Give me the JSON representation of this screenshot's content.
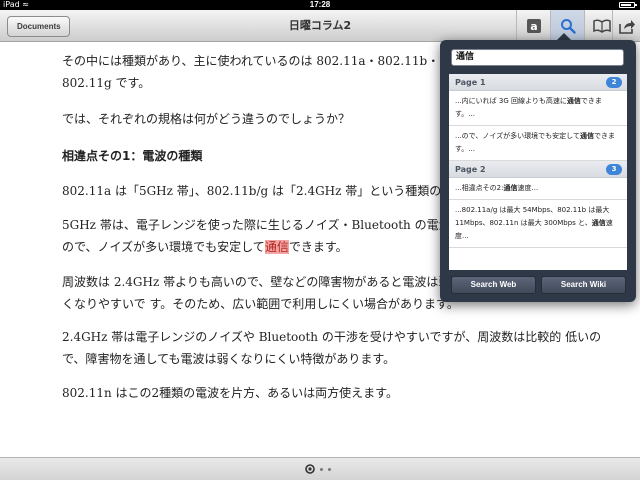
{
  "status_bar": {
    "carrier": "iPad",
    "time": "17:28",
    "battery_level": 0.85
  },
  "nav_bar": {
    "back_label": "Documents",
    "title": "日曜コラム2",
    "icons": [
      "font-icon",
      "search-icon",
      "book-icon",
      "share-icon"
    ]
  },
  "document": {
    "p1": "その中には種類があり、主に使われているのは 802.11a・802.11b・802.11g です。",
    "p2": "では、それぞれの規格は何がどう違うのでしょうか？",
    "heading": "相違点その1：電波の種類",
    "p3": "802.11a は「5GHz 帯」、802.11b/g は「2.4GHz 帯」という種類の電波を",
    "p4_before": "5GHz 帯は、電子レンジを使った際に生じるノイズ・Bluetooth の電波",
    "p4_line2_before": "ので、ノイズが多い環境でも安定して",
    "p4_highlight": "通信",
    "p4_after": "できます。",
    "p5": "周波数は 2.4GHz 帯よりも高いので、壁などの障害物があると電波は弱くなりやすいで す。そのため、広い範囲で利用しにくい場合があります。",
    "p6": "2.4GHz 帯は電子レンジのノイズや Bluetooth の干渉を受けやすいですが、周波数は比較的 低いので、障害物を通しても電波は弱くなりにくい特徴があります。",
    "p7": "802.11n はこの2種類の電波を片方、あるいは両方使えます。"
  },
  "search_popover": {
    "query": "通信",
    "sections": [
      {
        "title": "Page 1",
        "count": "2",
        "results": [
          {
            "before": "...内にいれば 3G 回線よりも高速に",
            "match": "通信",
            "after": "できます。..."
          },
          {
            "before": "...ので、ノイズが多い環境でも安定して",
            "match": "通信",
            "after": "できます。..."
          }
        ]
      },
      {
        "title": "Page 2",
        "count": "3",
        "results": [
          {
            "before": "...相違点その2:",
            "match": "通信",
            "after": "速度..."
          },
          {
            "before": "...802.11a/g は最大 54Mbps、802.11b は最大 11Mbps、802.11n は最大 300Mbps と、",
            "match": "通信",
            "after": "速度..."
          }
        ]
      }
    ],
    "search_web_label": "Search Web",
    "search_wiki_label": "Search Wiki"
  },
  "colors": {
    "highlight_bg": "#f4a6a6",
    "highlight_text": "#b3261e",
    "badge": "#3d85d8",
    "popover_bg": "#2f3847"
  }
}
